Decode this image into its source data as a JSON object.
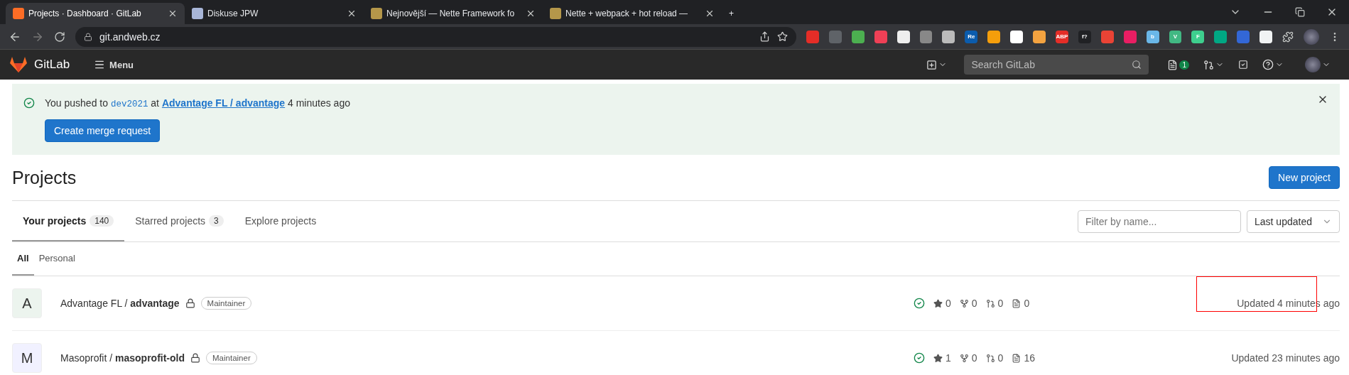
{
  "browser": {
    "tabs": [
      {
        "title": "Projects · Dashboard · GitLab",
        "selected": true
      },
      {
        "title": "Diskuse JPW",
        "selected": false
      },
      {
        "title": "Nejnovější — Nette Framework fo",
        "selected": false
      },
      {
        "title": "Nette + webpack + hot reload —",
        "selected": false
      }
    ],
    "new_tab": "+",
    "url": "git.andweb.cz",
    "extensions": [
      {
        "color": "#e52d27"
      },
      {
        "color": "#5f6368"
      },
      {
        "color": "#4caf50"
      },
      {
        "color": "#ef4056"
      },
      {
        "color": "#eeeeee"
      },
      {
        "color": "#888888"
      },
      {
        "color": "#bbbbbb"
      },
      {
        "color": "#0b5cad",
        "label": "Re"
      },
      {
        "color": "#f59e0b"
      },
      {
        "color": "#ffffff"
      },
      {
        "color": "#f4a340"
      },
      {
        "color": "#e52d27",
        "label": "ABP"
      },
      {
        "color": "#202124",
        "label": "f?"
      },
      {
        "color": "#ea4335"
      },
      {
        "color": "#e91e63"
      },
      {
        "color": "#6ab7e8",
        "label": "b"
      },
      {
        "color": "#41b883",
        "label": "V"
      },
      {
        "color": "#3ecf8e",
        "label": "F"
      },
      {
        "color": "#00a884"
      },
      {
        "color": "#3367d6"
      },
      {
        "color": "#f1f3f4"
      }
    ]
  },
  "topbar": {
    "brand": "GitLab",
    "menu": "Menu",
    "search": {
      "placeholder": "Search GitLab"
    },
    "issues_count": "1"
  },
  "alert": {
    "prefix": "You pushed to",
    "branch": "dev2021",
    "middle": "at",
    "project": "Advantage FL / advantage",
    "suffix": "4 minutes ago",
    "button": "Create merge request"
  },
  "page": {
    "title": "Projects",
    "new_button": "New project"
  },
  "tabs": [
    {
      "label": "Your projects",
      "count": "140",
      "selected": true
    },
    {
      "label": "Starred projects",
      "count": "3",
      "selected": false
    },
    {
      "label": "Explore projects",
      "selected": false
    }
  ],
  "filter": {
    "placeholder": "Filter by name..."
  },
  "sort": {
    "value": "Last updated"
  },
  "subtabs": [
    {
      "label": "All",
      "selected": true
    },
    {
      "label": "Personal",
      "selected": false
    }
  ],
  "projects": [
    {
      "avatar": "A",
      "namespace": "Advantage FL / ",
      "name": "advantage",
      "role": "Maintainer",
      "stars": "0",
      "forks": "0",
      "merge_requests": "0",
      "issues": "0",
      "updated": "Updated 4 minutes ago",
      "highlighted": true
    },
    {
      "avatar": "M",
      "namespace": "Masoprofit / ",
      "name": "masoprofit-old",
      "role": "Maintainer",
      "stars": "1",
      "forks": "0",
      "merge_requests": "0",
      "issues": "16",
      "updated": "Updated 23 minutes ago",
      "highlighted": false
    }
  ]
}
